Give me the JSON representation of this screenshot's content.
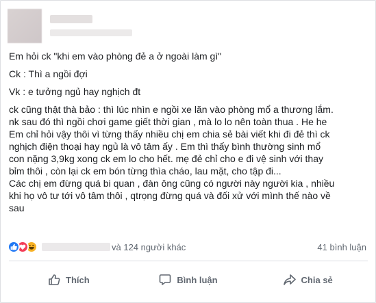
{
  "post": {
    "lines": [
      "Em hỏi ck \"khi em vào phòng đẻ a ở ngoài làm gì\"",
      "Ck : Thì a ngồi đợi",
      "Vk : e tưởng ngủ hay nghịch đt",
      "ck cũng thật thà bảo : thì lúc nhìn e ngồi xe lăn vào phòng mổ a thương lắm.",
      "nk sau đó thì ngồi chơi game giết thời gian , mà lo lo nên toàn thua . He he",
      "Em chỉ hỏi vậy thôi vì từng thấy nhiều chị em chia sẻ bài viết khi đi đẻ thì ck",
      "nghịch điện thoại hay ngủ là vô tâm ấy . Em thì thấy bình thường sinh mổ",
      "con nặng 3,9kg xong ck em lo cho hết. mẹ đẻ chỉ cho e đi vệ sinh với thay",
      "bỉm thôi , còn lại ck em bón từng thìa cháo, lau mặt, cho tập đi...",
      "Các chị em đừng quá bi quan , đàn ông cũng có người này người kia , nhiều",
      "khi họ vô tư tới vô tâm thôi , qtrọng đừng quá và đối xử với mình thế nào về",
      "sau"
    ]
  },
  "reactions": {
    "others_text": "và 124 người khác",
    "comments_text": "41 bình luận"
  },
  "actions": {
    "like_label": "Thích",
    "comment_label": "Bình luận",
    "share_label": "Chia sẻ"
  },
  "colors": {
    "like_blue": "#2078f4",
    "love_red": "#f33e58",
    "haha_yellow": "#f7b125",
    "muted_text": "#606770"
  }
}
